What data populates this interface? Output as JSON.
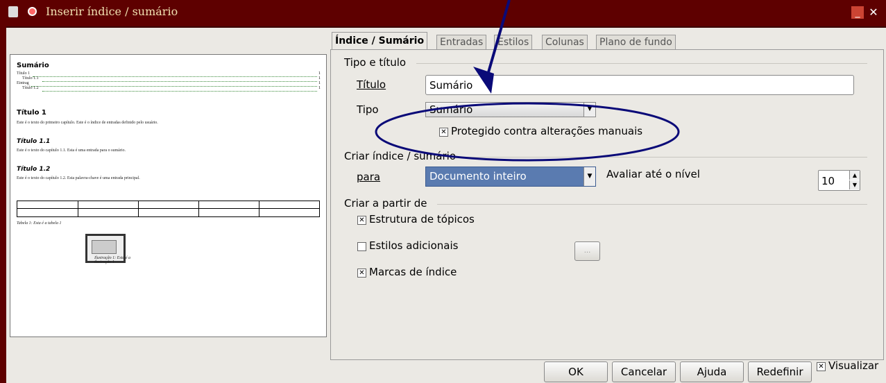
{
  "window": {
    "title": "Inserir índice / sumário"
  },
  "tabs": [
    "Índice / Sumário",
    "Entradas",
    "Estilos",
    "Colunas",
    "Plano de fundo"
  ],
  "preview": {
    "heading": "Sumário",
    "toc": [
      {
        "text": "Título 1",
        "page": "1"
      },
      {
        "text": "Título 1.1",
        "page": "1"
      },
      {
        "text": "Eintrag",
        "page": "1"
      },
      {
        "text": "Título 1.2",
        "page": "1"
      }
    ],
    "h1": "Título 1",
    "p1": "Este é o texto do primeiro capítulo. Este é o índice de entradas definido pelo usuário.",
    "h2": "Título 1.1",
    "p2": "Este é o texto do capítulo 1.1. Esta é uma entrada para o sumário.",
    "h3": "Título 1.2",
    "p3": "Este é o texto do capítulo 1.2. Esta palavra-chave é uma entrada principal.",
    "table_caption": "Tabela 1: Esta é a tabela 1",
    "illus_caption": "Ilustração 1: Esta é a ilustração 1"
  },
  "type_title": {
    "section": "Tipo e título",
    "title_label": "Título",
    "title_value": "Sumário",
    "type_label": "Tipo",
    "type_value": "Sumário",
    "protected_label": "Protegido contra alterações manuais",
    "protected_checked": true
  },
  "create_index": {
    "section": "Criar índice / sumário",
    "for_label": "para",
    "for_value": "Documento inteiro",
    "level_label": "Avaliar até o nível",
    "level_value": "10"
  },
  "create_from": {
    "section": "Criar a partir de",
    "outline": {
      "label": "Estrutura de tópicos",
      "checked": true
    },
    "additional": {
      "label": "Estilos adicionais",
      "checked": false
    },
    "ellipsis_button": "...",
    "marks": {
      "label": "Marcas de índice",
      "checked": true
    }
  },
  "buttons": {
    "ok": "OK",
    "cancel": "Cancelar",
    "help": "Ajuda",
    "reset": "Redefinir"
  },
  "preview_toggle": {
    "label": "Visualizar",
    "checked": true
  },
  "annotation_color": "#0a0a78"
}
